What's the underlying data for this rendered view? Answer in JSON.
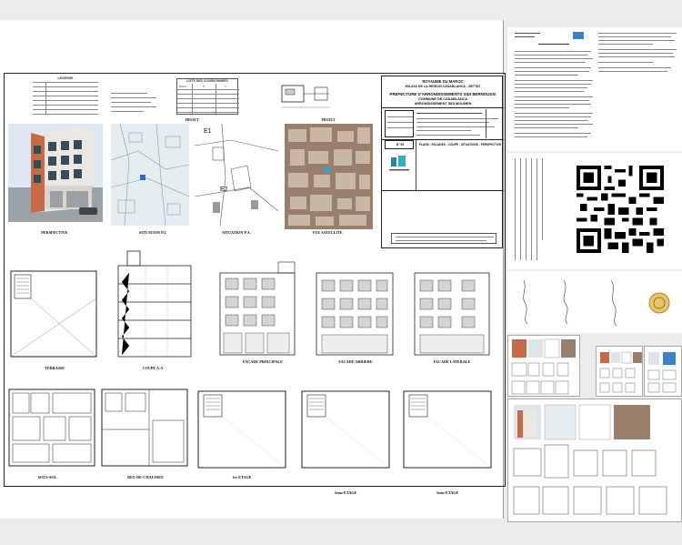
{
  "main_sheet": {
    "title_block": {
      "kingdom": "ROYAUME DU MAROC",
      "wilaya": "WILAYA DE LA REGION CASABLANCA - SETTAT",
      "prefecture": "PREFECTURE D'ARRONDISSEMENTS SIDI BERNOUSSI",
      "commune": "COMMUNE DE CASABLANCA",
      "arrondissement": "ARRONDISSEMENT SIDI MOUMEN",
      "sheet_no": "N° 05",
      "contents": "PLANS - FACADES - COUPE - SITUATIONS - PERSPECTIVE"
    },
    "legend_title": "LEGENDE",
    "coords_title": "LISTE DES COORDONNEES",
    "coords_headers": [
      "Borne",
      "X",
      "Y"
    ],
    "section_projet_1": "PROJET",
    "section_projet_2": "PROJET",
    "labels": {
      "perspective": "PERSPECTIVE",
      "situation_pi": "SITUATION P.I.",
      "situation_pa": "SITUATION P.A.",
      "vue_satellite": "VUE SATELLITE",
      "terrasse": "TERRASSE",
      "coupe": "COUPE A-A",
      "facade_principale": "FACADE PRINCIPALE",
      "facade_arriere": "FACADE ARRIERE",
      "facade_laterale": "FACADE LATERALE",
      "sous_sol": "SOUS-SOL",
      "rez": "REZ-DE-CHAUSSEE",
      "etage1": "1er ETAGE",
      "etage2": "2eme ETAGE",
      "etage3": "3eme ETAGE"
    },
    "map_marks": {
      "e1": "E1",
      "e2": "E2"
    }
  }
}
